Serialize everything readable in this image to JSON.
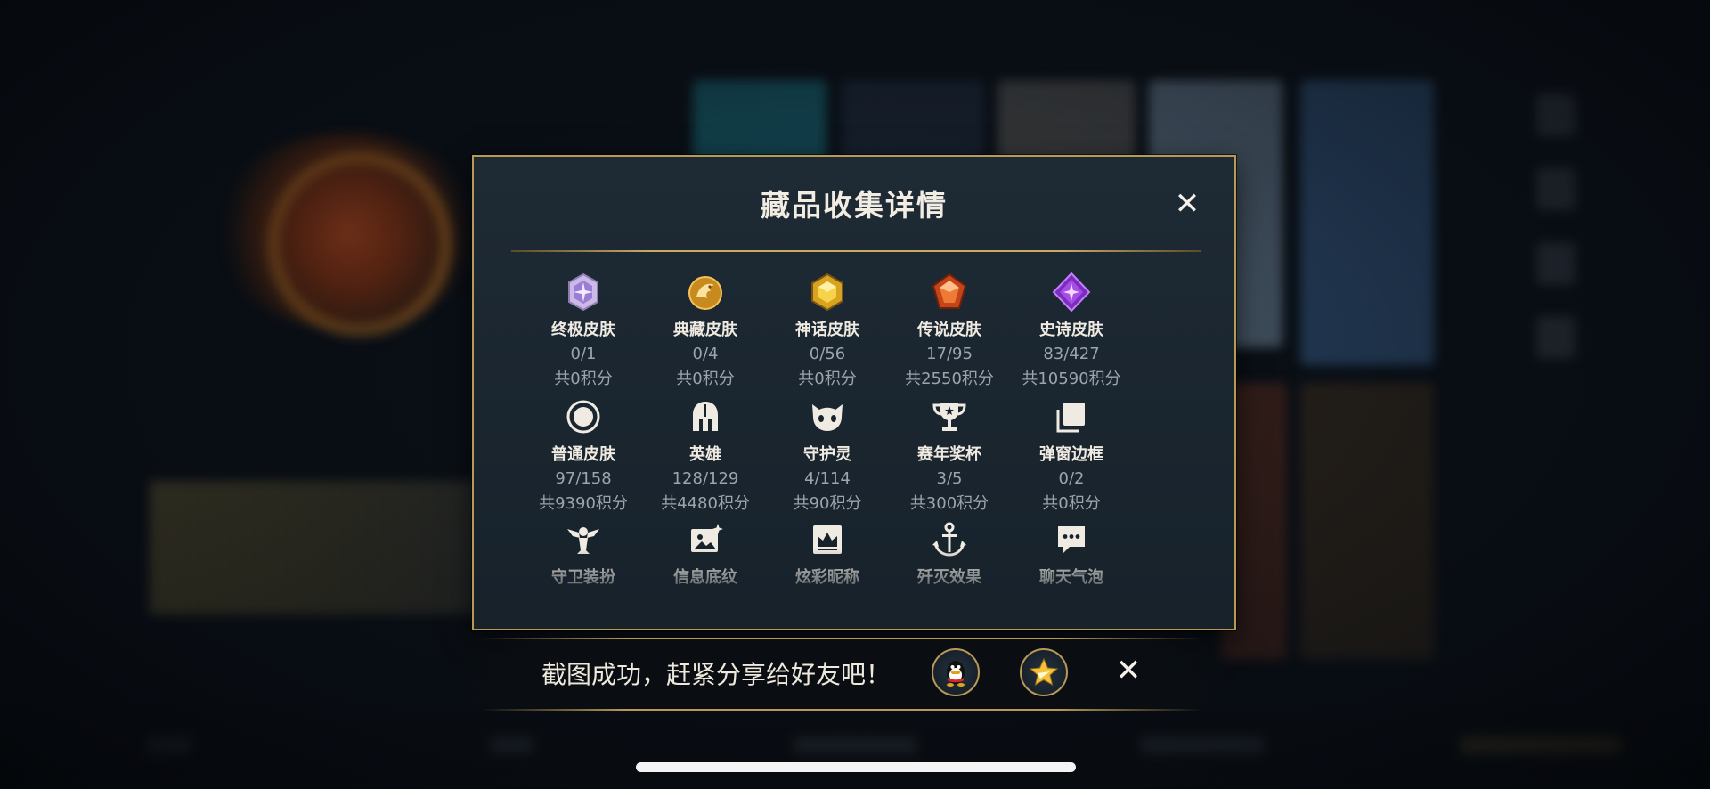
{
  "dialog": {
    "title": "藏品收集详情"
  },
  "collection_rows": [
    [
      {
        "name": "终极皮肤",
        "count": "0/1",
        "points": "共0积分",
        "icon": "ultimate-skin-gem-icon"
      },
      {
        "name": "典藏皮肤",
        "count": "0/4",
        "points": "共0积分",
        "icon": "treasured-skin-dragon-icon"
      },
      {
        "name": "神话皮肤",
        "count": "0/56",
        "points": "共0积分",
        "icon": "mythic-skin-gem-icon"
      },
      {
        "name": "传说皮肤",
        "count": "17/95",
        "points": "共2550积分",
        "icon": "legend-skin-gem-icon"
      },
      {
        "name": "史诗皮肤",
        "count": "83/427",
        "points": "共10590积分",
        "icon": "epic-skin-gem-icon"
      }
    ],
    [
      {
        "name": "普通皮肤",
        "count": "97/158",
        "points": "共9390积分",
        "icon": "normal-skin-circle-icon"
      },
      {
        "name": "英雄",
        "count": "128/129",
        "points": "共4480积分",
        "icon": "hero-helmet-icon"
      },
      {
        "name": "守护灵",
        "count": "4/114",
        "points": "共90积分",
        "icon": "guardian-spirit-icon"
      },
      {
        "name": "赛年奖杯",
        "count": "3/5",
        "points": "共300积分",
        "icon": "season-trophy-icon"
      },
      {
        "name": "弹窗边框",
        "count": "0/2",
        "points": "共0积分",
        "icon": "popup-frame-icon"
      }
    ],
    [
      {
        "name": "守卫装扮",
        "icon": "guard-outfit-icon"
      },
      {
        "name": "信息底纹",
        "icon": "info-background-icon"
      },
      {
        "name": "炫彩昵称",
        "icon": "colorful-nickname-icon"
      },
      {
        "name": "歼灭效果",
        "icon": "annihilation-effect-icon"
      },
      {
        "name": "聊天气泡",
        "icon": "chat-bubble-icon"
      }
    ]
  ],
  "share": {
    "message": "截图成功，赶紧分享给好友吧！",
    "targets": [
      "qq-icon",
      "qzone-star-icon"
    ]
  }
}
